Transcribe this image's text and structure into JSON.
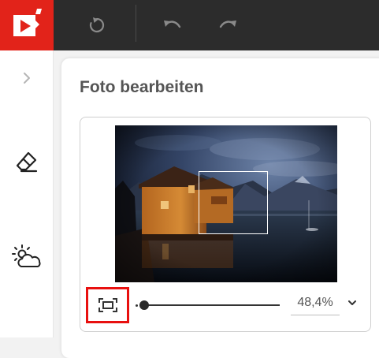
{
  "toolbar": {
    "logo_icon": "video-play-logo-icon",
    "reset_icon": "rotate-reset-icon",
    "undo_icon": "undo-icon",
    "redo_icon": "redo-icon"
  },
  "sidebar": {
    "items": [
      {
        "icon": "chevron-right-icon"
      },
      {
        "icon": "eraser-icon"
      },
      {
        "icon": "weather-sun-cloud-icon"
      }
    ]
  },
  "panel": {
    "title": "Foto bearbeiten"
  },
  "editor": {
    "fit_icon": "fit-to-frame-icon",
    "zoom_value": "48,4%",
    "zoom_slider_level_percent": 0,
    "zoom_dropdown_icon": "chevron-down-icon"
  },
  "colors": {
    "brand_red": "#e2231a",
    "topbar": "#2c2c2c",
    "highlight_red": "#e8100f",
    "text_gray": "#555555"
  }
}
